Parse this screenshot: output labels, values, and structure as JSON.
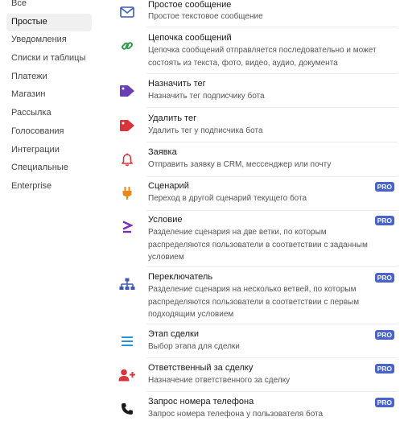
{
  "sidebar": {
    "items": [
      {
        "label": "Все"
      },
      {
        "label": "Простые"
      },
      {
        "label": "Уведомления"
      },
      {
        "label": "Списки и таблицы"
      },
      {
        "label": "Платежи"
      },
      {
        "label": "Магазин"
      },
      {
        "label": "Рассылка"
      },
      {
        "label": "Голосования"
      },
      {
        "label": "Интеграции"
      },
      {
        "label": "Специальные"
      },
      {
        "label": "Enterprise"
      }
    ],
    "active_index": 1
  },
  "blocks": {
    "pro_label": "PRO",
    "items": [
      {
        "icon": "envelope-icon",
        "title": "Простое сообщение",
        "desc": "Простое текстовое сообщение",
        "pro": false
      },
      {
        "icon": "link-icon",
        "title": "Цепочка сообщений",
        "desc": "Цепочка сообщений отправляется последовательно и может состоять из текста, фото, видео, аудио, документа",
        "pro": false
      },
      {
        "icon": "tag-icon",
        "title": "Назначить тег",
        "desc": "Назначить тег подписчику бота",
        "pro": false
      },
      {
        "icon": "tag-icon",
        "title": "Удалить тег",
        "desc": "Удалить тег у подписчика бота",
        "pro": false
      },
      {
        "icon": "bell-icon",
        "title": "Заявка",
        "desc": "Отправить заявку в CRM, мессенджер или почту",
        "pro": false
      },
      {
        "icon": "plug-icon",
        "title": "Сценарий",
        "desc": "Переход в другой сценарий текущего бота",
        "pro": true
      },
      {
        "icon": "greater-equal-icon",
        "title": "Условие",
        "desc": "Разделение сценария на две ветки, по которым распределяются пользователи в соответствии с заданным условием",
        "pro": true
      },
      {
        "icon": "sitemap-icon",
        "title": "Переключатель",
        "desc": "Разделение сценария на несколько ветвей, по которым распределяются пользователи в соответствии с первым подходящим условием",
        "pro": true
      },
      {
        "icon": "list-icon",
        "title": "Этап сделки",
        "desc": "Выбор этапа для сделки",
        "pro": true
      },
      {
        "icon": "user-plus-icon",
        "title": "Ответственный за сделку",
        "desc": "Назначение ответственного за сделку",
        "pro": true
      },
      {
        "icon": "phone-icon",
        "title": "Запрос номера телефона",
        "desc": "Запрос номера телефона у пользователя бота",
        "pro": true
      }
    ]
  },
  "colors": {
    "envelope": "#3b5bb3",
    "link": "#2e9a4a",
    "tag_add": "#6a3fb5",
    "tag_remove": "#d8343c",
    "bell": "#d8343c",
    "plug": "#e8891a",
    "condition": "#7a2fb5",
    "sitemap": "#3b5bb3",
    "list": "#2d8fd6",
    "user_plus": "#d8343c",
    "phone": "#1a1a1a",
    "pro_badge": "#4a63c9"
  }
}
